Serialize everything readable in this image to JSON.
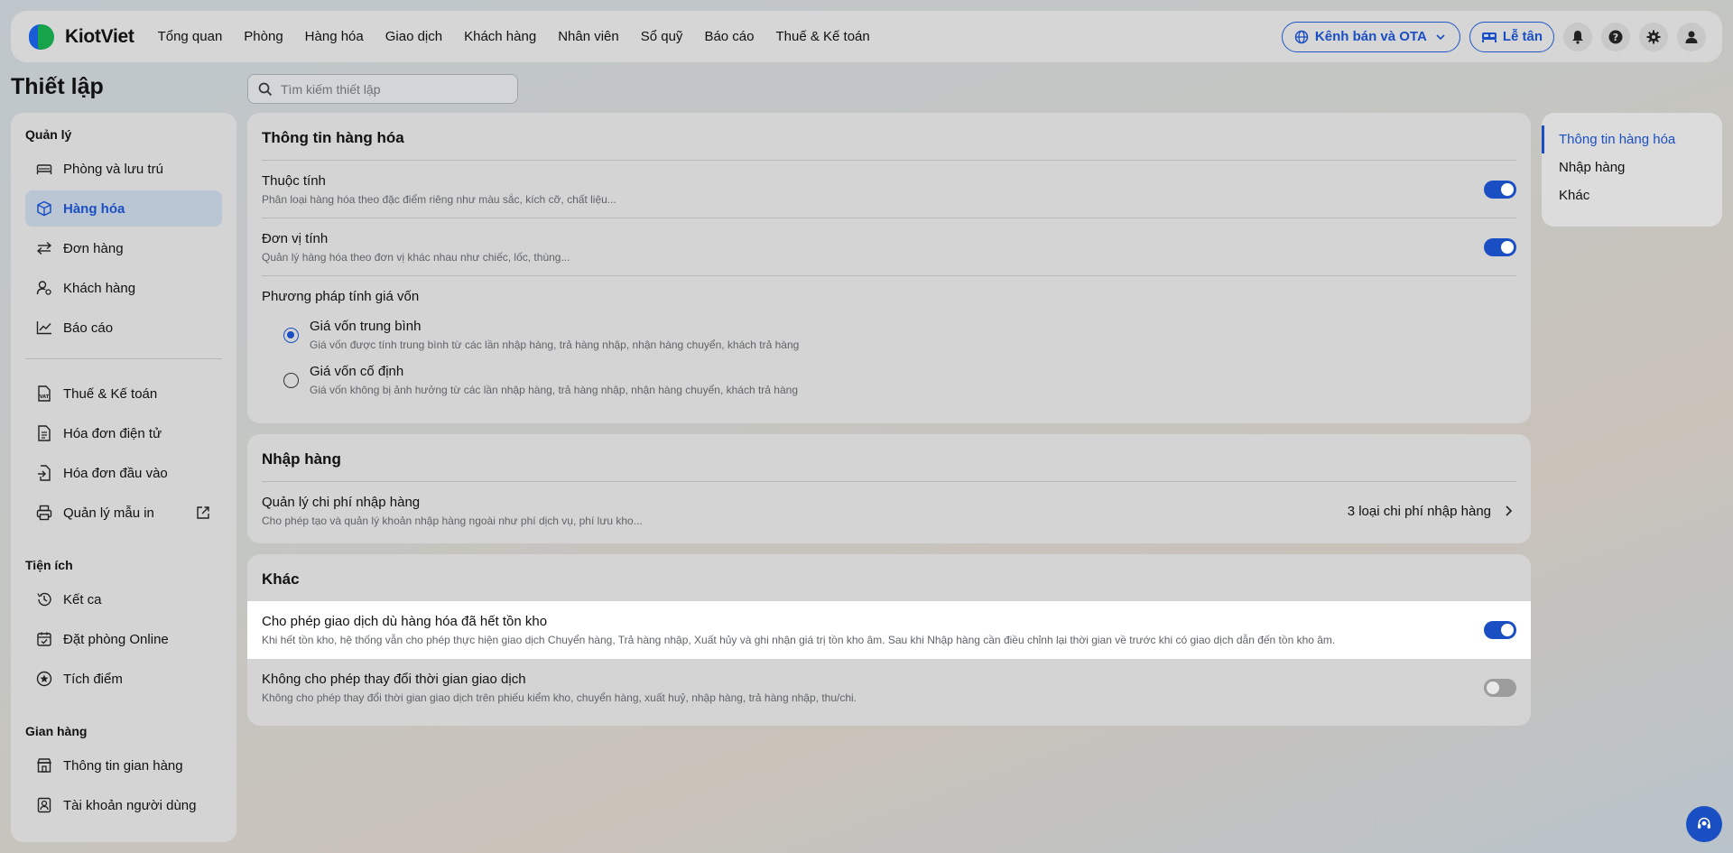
{
  "brand": {
    "name": "KiotViet"
  },
  "nav": {
    "items": [
      "Tổng quan",
      "Phòng",
      "Hàng hóa",
      "Giao dịch",
      "Khách hàng",
      "Nhân viên",
      "Sổ quỹ",
      "Báo cáo",
      "Thuế & Kế toán"
    ]
  },
  "topbar": {
    "channel_label": "Kênh bán và OTA",
    "reception_label": "Lễ tân"
  },
  "page": {
    "title": "Thiết lập",
    "search_placeholder": "Tìm kiếm thiết lập"
  },
  "sidebar": {
    "groups": [
      {
        "label": "Quản lý"
      },
      {
        "label": "Tiện ích"
      },
      {
        "label": "Gian hàng"
      }
    ],
    "items": [
      {
        "label": "Phòng và lưu trú",
        "icon": "bed-icon"
      },
      {
        "label": "Hàng hóa",
        "icon": "box-icon",
        "active": true
      },
      {
        "label": "Đơn hàng",
        "icon": "swap-icon"
      },
      {
        "label": "Khách hàng",
        "icon": "user-settings-icon"
      },
      {
        "label": "Báo cáo",
        "icon": "chart-line-icon"
      },
      {
        "label": "Thuế & Kế toán",
        "icon": "vat-document-icon"
      },
      {
        "label": "Hóa đơn điện tử",
        "icon": "document-icon"
      },
      {
        "label": "Hóa đơn đầu vào",
        "icon": "document-import-icon"
      },
      {
        "label": "Quản lý mẫu in",
        "icon": "printer-icon"
      },
      {
        "label": "Kết ca",
        "icon": "history-icon"
      },
      {
        "label": "Đặt phòng Online",
        "icon": "calendar-check-icon"
      },
      {
        "label": "Tích điểm",
        "icon": "star-circle-icon"
      },
      {
        "label": "Thông tin gian hàng",
        "icon": "store-icon"
      },
      {
        "label": "Tài khoản người dùng",
        "icon": "user-badge-icon"
      }
    ]
  },
  "sections": {
    "goods": {
      "title": "Thông tin hàng hóa",
      "attributes": {
        "title": "Thuộc tính",
        "desc": "Phân loại hàng hóa theo đặc điểm riêng như màu sắc, kích cỡ, chất liệu...",
        "enabled": true
      },
      "units": {
        "title": "Đơn vị tính",
        "desc": "Quản lý hàng hóa theo đơn vị khác nhau như chiếc, lốc, thùng...",
        "enabled": true
      },
      "cost_method": {
        "label": "Phương pháp tính giá vốn",
        "options": [
          {
            "title": "Giá vốn trung bình",
            "desc": "Giá vốn được tính trung bình từ các lần nhập hàng, trả hàng nhập, nhận hàng chuyển, khách trả hàng",
            "selected": true
          },
          {
            "title": "Giá vốn cố định",
            "desc": "Giá vốn không bị ảnh hưởng từ các lần nhập hàng, trả hàng nhập, nhận hàng chuyển, khách trả hàng",
            "selected": false
          }
        ]
      }
    },
    "import": {
      "title": "Nhập hàng",
      "cost_mgmt": {
        "title": "Quản lý chi phí nhập hàng",
        "desc": "Cho phép tạo và quản lý khoản nhập hàng ngoài như phí dịch vụ, phí lưu kho...",
        "value": "3 loại chi phí nhập hàng"
      }
    },
    "other": {
      "title": "Khác",
      "allow_out_of_stock": {
        "title": "Cho phép giao dịch dù hàng hóa đã hết tồn kho",
        "desc": "Khi hết tồn kho, hệ thống vẫn cho phép thực hiện giao dịch Chuyển hàng, Trả hàng nhập, Xuất hủy và ghi nhận giá trị tồn kho âm. Sau khi Nhập hàng cần điều chỉnh lại thời gian về trước khi có giao dịch dẫn đến tồn kho âm.",
        "enabled": true
      },
      "lock_time": {
        "title": "Không cho phép thay đổi thời gian giao dịch",
        "desc": "Không cho phép thay đổi thời gian giao dịch trên phiếu kiểm kho, chuyển hàng, xuất huỷ, nhập hàng, trả hàng nhập, thu/chi.",
        "enabled": false
      }
    }
  },
  "anchors": {
    "items": [
      {
        "label": "Thông tin hàng hóa",
        "active": true
      },
      {
        "label": "Nhập hàng",
        "active": false
      },
      {
        "label": "Khác",
        "active": false
      }
    ]
  },
  "colors": {
    "accent": "#1a4fc4",
    "brand_green": "#16a34a"
  }
}
